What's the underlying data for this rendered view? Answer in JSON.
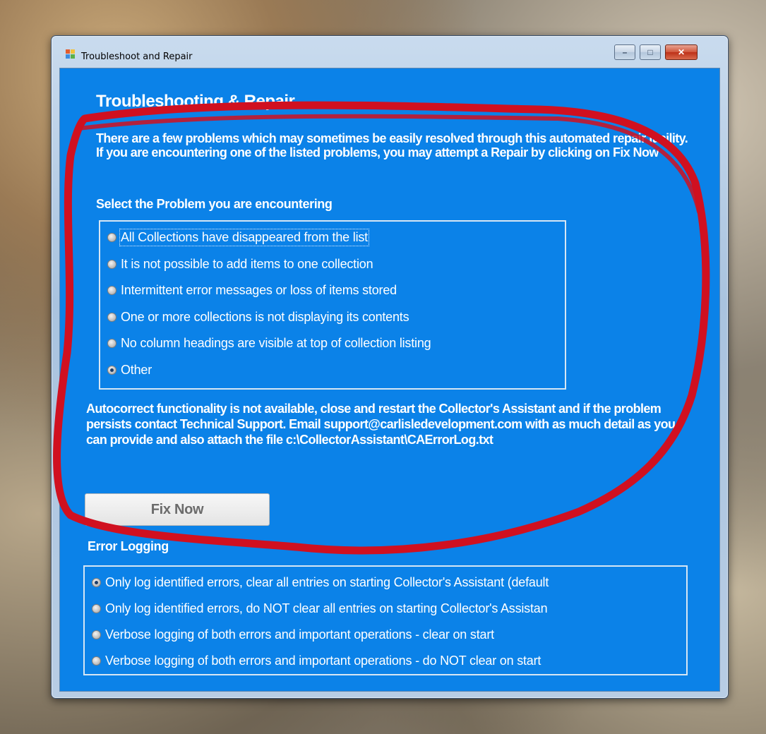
{
  "window": {
    "title": "Troubleshoot and Repair",
    "controls": {
      "minimize": "–",
      "maximize": "□",
      "close": "✕"
    }
  },
  "header": {
    "title": "Troubleshooting & Repair"
  },
  "intro": "There are a few problems which may sometimes be easily resolved through this automated repair facility.  If you are encountering one of the listed problems, you may attempt a Repair by clicking on Fix Now",
  "problems": {
    "label": "Select the Problem you are encountering",
    "options": [
      "All Collections have disappeared from the list",
      "It is not possible to add items to one collection",
      "Intermittent error messages or loss of items stored",
      "One or more collections is not displaying its contents",
      "No column headings are visible at top of collection listing",
      "Other"
    ],
    "selected": "Other"
  },
  "message": "Autocorrect functionality is not available, close and restart the Collector's Assistant and if the problem persists contact Technical Support. Email support@carlisledevelopment.com with as much detail as you can provide and also attach the file c:\\CollectorAssistant\\CAErrorLog.txt",
  "fix_button": "Fix Now",
  "logging": {
    "label": "Error Logging",
    "options": [
      "Only log identified errors, clear all entries on starting Collector's Assistant (default",
      "Only log identified errors, do NOT clear all entries on starting Collector's Assistan",
      "Verbose logging of both errors and important operations - clear on start",
      "Verbose logging of both errors and important operations - do NOT clear on start"
    ],
    "selected": "Only log identified errors, clear all entries on starting Collector's Assistant (default"
  },
  "colors": {
    "client_background": "#0b82e8",
    "annotation_stroke": "#d01020",
    "button_text": "#6b6b6b"
  }
}
